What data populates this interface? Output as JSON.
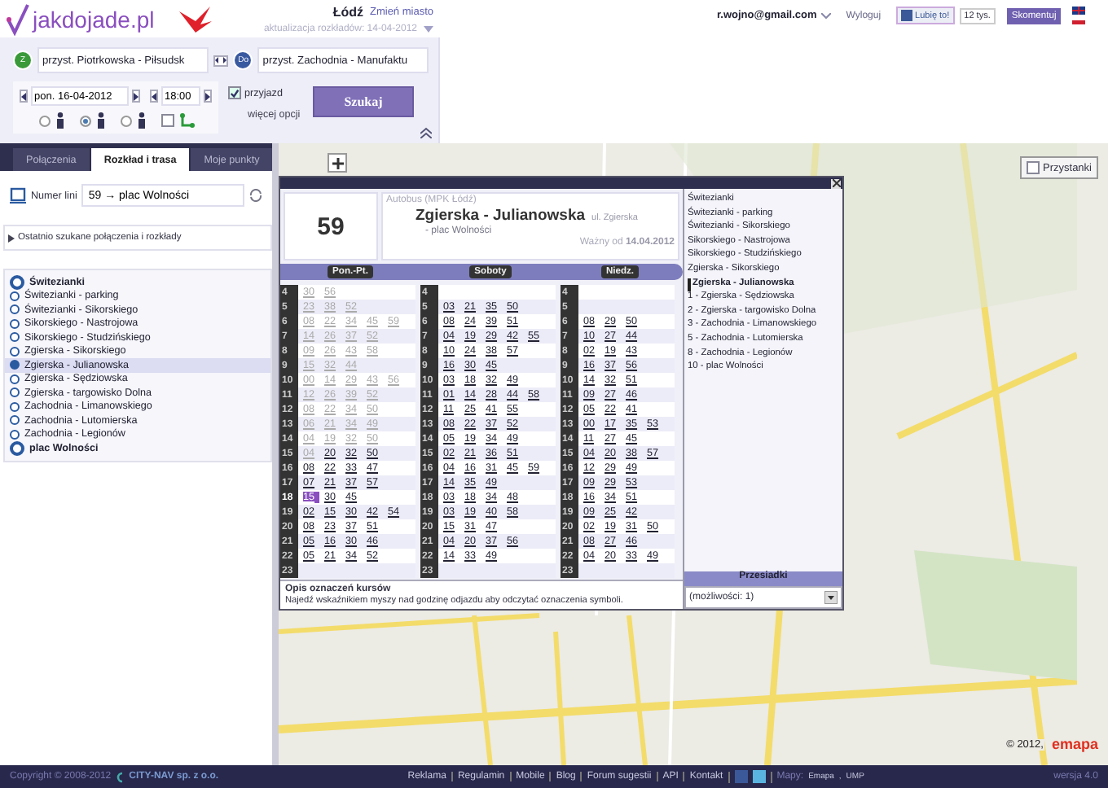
{
  "header": {
    "logo": "jakdojade.pl",
    "city": "Łódź",
    "change_city": "Zmień miasto",
    "update_note": "aktualizacja rozkładów: 14-04-2012",
    "from": {
      "badge": "Z",
      "value": "przyst. Piotrkowska - Piłsudsk"
    },
    "to": {
      "badge": "Do",
      "value": "przyst. Zachodnia - Manufaktu"
    },
    "date": "pon. 16-04-2012",
    "time": "18:00",
    "arrival": {
      "label": "przyjazd",
      "checked": true
    },
    "modes": [
      {
        "selected": false
      },
      {
        "selected": true
      },
      {
        "selected": false
      }
    ],
    "route_option": {
      "checked": false
    },
    "more_options": "więcej opcji",
    "search_button": "Szukaj"
  },
  "user_bar": {
    "email": "r.wojno@gmail.com",
    "logout": "Wyloguj",
    "like": "Lubię to!",
    "like_count": "12 tys.",
    "comment": "Skomentuj"
  },
  "sidebar": {
    "tabs": [
      {
        "label": "Połączenia",
        "selected": false
      },
      {
        "label": "Rozkład i trasa",
        "selected": true
      },
      {
        "label": "Moje punkty",
        "selected": false
      }
    ],
    "line_label": "Numer lini",
    "line_value": "59 → plac Wolności",
    "recent": "Ostatnio szukane połączenia i rozkłady",
    "stops": [
      {
        "name": "Świtezianki",
        "terminal": true,
        "selected": false
      },
      {
        "name": "Świtezianki - parking",
        "terminal": false,
        "selected": false
      },
      {
        "name": "Świtezianki - Sikorskiego",
        "terminal": false,
        "selected": false
      },
      {
        "name": "Sikorskiego - Nastrojowa",
        "terminal": false,
        "selected": false
      },
      {
        "name": "Sikorskiego - Studzińskiego",
        "terminal": false,
        "selected": false
      },
      {
        "name": "Zgierska - Sikorskiego",
        "terminal": false,
        "selected": false
      },
      {
        "name": "Zgierska - Julianowska",
        "terminal": false,
        "selected": true
      },
      {
        "name": "Zgierska - Sędziowska",
        "terminal": false,
        "selected": false
      },
      {
        "name": "Zgierska - targowisko Dolna",
        "terminal": false,
        "selected": false
      },
      {
        "name": "Zachodnia - Limanowskiego",
        "terminal": false,
        "selected": false
      },
      {
        "name": "Zachodnia - Lutomierska",
        "terminal": false,
        "selected": false
      },
      {
        "name": "Zachodnia - Legionów",
        "terminal": false,
        "selected": false
      },
      {
        "name": "plac Wolności",
        "terminal": true,
        "selected": false
      }
    ]
  },
  "map": {
    "stops_toggle": {
      "label": "Przystanki",
      "checked": false
    },
    "copyright": "© 2012,",
    "provider": "emapa"
  },
  "timetable": {
    "line": "59",
    "vehicle": "Autobus (MPK Łódź)",
    "stop": "Zgierska - Julianowska",
    "street": "ul. Zgierska",
    "direction": "- plac Wolności",
    "valid": "Ważny od **14.04.2012**",
    "columns": [
      {
        "label": "Pon.-Pt.",
        "rows": [
          {
            "hour": "4",
            "past": [
              "30",
              "56"
            ],
            "highlight": false
          },
          {
            "hour": "5",
            "past": [
              "23",
              "38",
              "52"
            ],
            "highlight": false
          },
          {
            "hour": "6",
            "past": [
              "08",
              "22",
              "34",
              "45",
              "59"
            ],
            "highlight": false
          },
          {
            "hour": "7",
            "past": [
              "14",
              "26",
              "37",
              "52"
            ],
            "highlight": false
          },
          {
            "hour": "8",
            "past": [
              "09",
              "26",
              "43",
              "58"
            ],
            "highlight": false
          },
          {
            "hour": "9",
            "past": [
              "15",
              "32",
              "44"
            ],
            "highlight": false
          },
          {
            "hour": "10",
            "past": [
              "00",
              "14",
              "29",
              "43",
              "56"
            ],
            "highlight": false
          },
          {
            "hour": "11",
            "past": [
              "12",
              "26",
              "39",
              "52"
            ],
            "highlight": false
          },
          {
            "hour": "12",
            "past": [
              "08",
              "22",
              "34",
              "50"
            ],
            "highlight": false
          },
          {
            "hour": "13",
            "past": [
              "06",
              "21",
              "34",
              "49"
            ],
            "highlight": false
          },
          {
            "hour": "14",
            "past": [
              "04",
              "19",
              "32",
              "50"
            ],
            "highlight": false
          },
          {
            "hour": "15",
            "past": [
              "04"
            ],
            "next": [
              "20",
              "32",
              "50"
            ],
            "highlight": false
          },
          {
            "hour": "16",
            "next": [
              "08",
              "22",
              "33",
              "47"
            ],
            "highlight": false
          },
          {
            "hour": "17",
            "next": [
              "07",
              "21",
              "37",
              "57"
            ],
            "highlight": false
          },
          {
            "hour": "18",
            "next": [
              "15",
              "30",
              "45"
            ],
            "highlight": true
          },
          {
            "hour": "19",
            "next": [
              "02",
              "15",
              "30",
              "42",
              "54"
            ],
            "highlight": false
          },
          {
            "hour": "20",
            "next": [
              "08",
              "23",
              "37",
              "51"
            ],
            "highlight": false
          },
          {
            "hour": "21",
            "next": [
              "05",
              "16",
              "30",
              "46"
            ],
            "highlight": false
          },
          {
            "hour": "22",
            "next": [
              "05",
              "21",
              "34",
              "52"
            ],
            "highlight": false
          },
          {
            "hour": "23",
            "highlight": false
          }
        ]
      },
      {
        "label": "Soboty",
        "rows": [
          {
            "hour": "4",
            "highlight": false
          },
          {
            "hour": "5",
            "next": [
              "03",
              "21",
              "35",
              "50"
            ],
            "highlight": false
          },
          {
            "hour": "6",
            "next": [
              "08",
              "24",
              "39",
              "51"
            ],
            "highlight": false
          },
          {
            "hour": "7",
            "next": [
              "04",
              "19",
              "29",
              "42",
              "55"
            ],
            "highlight": false
          },
          {
            "hour": "8",
            "next": [
              "10",
              "24",
              "38",
              "57"
            ],
            "highlight": false
          },
          {
            "hour": "9",
            "next": [
              "16",
              "30",
              "45"
            ],
            "highlight": false
          },
          {
            "hour": "10",
            "next": [
              "03",
              "18",
              "32",
              "49"
            ],
            "highlight": false
          },
          {
            "hour": "11",
            "next": [
              "01",
              "14",
              "28",
              "44",
              "58"
            ],
            "highlight": false
          },
          {
            "hour": "12",
            "next": [
              "11",
              "25",
              "41",
              "55"
            ],
            "highlight": false
          },
          {
            "hour": "13",
            "next": [
              "08",
              "22",
              "37",
              "52"
            ],
            "highlight": false
          },
          {
            "hour": "14",
            "next": [
              "05",
              "19",
              "34",
              "49"
            ],
            "highlight": false
          },
          {
            "hour": "15",
            "next": [
              "02",
              "21",
              "36",
              "51"
            ],
            "highlight": false
          },
          {
            "hour": "16",
            "next": [
              "04",
              "16",
              "31",
              "45",
              "59"
            ],
            "highlight": false
          },
          {
            "hour": "17",
            "next": [
              "14",
              "35",
              "49"
            ],
            "highlight": false
          },
          {
            "hour": "18",
            "next": [
              "03",
              "18",
              "34",
              "48"
            ],
            "highlight": false
          },
          {
            "hour": "19",
            "next": [
              "03",
              "19",
              "40",
              "58"
            ],
            "highlight": false
          },
          {
            "hour": "20",
            "next": [
              "15",
              "31",
              "47"
            ],
            "highlight": false
          },
          {
            "hour": "21",
            "next": [
              "04",
              "20",
              "37",
              "56"
            ],
            "highlight": false
          },
          {
            "hour": "22",
            "next": [
              "14",
              "33",
              "49"
            ],
            "highlight": false
          },
          {
            "hour": "23",
            "highlight": false
          }
        ]
      },
      {
        "label": "Niedz.",
        "rows": [
          {
            "hour": "4",
            "highlight": false
          },
          {
            "hour": "5",
            "highlight": false
          },
          {
            "hour": "6",
            "next": [
              "08",
              "29",
              "50"
            ],
            "highlight": false
          },
          {
            "hour": "7",
            "next": [
              "10",
              "27",
              "44"
            ],
            "highlight": false
          },
          {
            "hour": "8",
            "next": [
              "02",
              "19",
              "43"
            ],
            "highlight": false
          },
          {
            "hour": "9",
            "next": [
              "16",
              "37",
              "56"
            ],
            "highlight": false
          },
          {
            "hour": "10",
            "next": [
              "14",
              "32",
              "51"
            ],
            "highlight": false
          },
          {
            "hour": "11",
            "next": [
              "09",
              "27",
              "46"
            ],
            "highlight": false
          },
          {
            "hour": "12",
            "next": [
              "05",
              "22",
              "41"
            ],
            "highlight": false
          },
          {
            "hour": "13",
            "next": [
              "00",
              "17",
              "35",
              "53"
            ],
            "highlight": false
          },
          {
            "hour": "14",
            "next": [
              "11",
              "27",
              "45"
            ],
            "highlight": false
          },
          {
            "hour": "15",
            "next": [
              "04",
              "20",
              "38",
              "57"
            ],
            "highlight": false
          },
          {
            "hour": "16",
            "next": [
              "12",
              "29",
              "49"
            ],
            "highlight": false
          },
          {
            "hour": "17",
            "next": [
              "09",
              "29",
              "53"
            ],
            "highlight": false
          },
          {
            "hour": "18",
            "next": [
              "16",
              "34",
              "51"
            ],
            "highlight": false
          },
          {
            "hour": "19",
            "next": [
              "09",
              "25",
              "42"
            ],
            "highlight": false
          },
          {
            "hour": "20",
            "next": [
              "02",
              "19",
              "31",
              "50"
            ],
            "highlight": false
          },
          {
            "hour": "21",
            "next": [
              "08",
              "27",
              "46"
            ],
            "highlight": false
          },
          {
            "hour": "22",
            "next": [
              "04",
              "20",
              "33",
              "49"
            ],
            "highlight": false
          },
          {
            "hour": "23",
            "highlight": false
          }
        ]
      }
    ],
    "legend_title": "Opis oznaczeń kursów",
    "legend_text": "Najedź wskaźnikiem myszy nad godzinę odjazdu aby odczytać oznaczenia symboli.",
    "stops": [
      {
        "name": "Świtezianki",
        "current": false
      },
      {
        "name": "Świtezianki - parking",
        "current": false
      },
      {
        "name": "Świtezianki - Sikorskiego",
        "current": false
      },
      {
        "name": "Sikorskiego - Nastrojowa",
        "current": false
      },
      {
        "name": "Sikorskiego - Studzińskiego",
        "current": false
      },
      {
        "name": "Zgierska - Sikorskiego",
        "current": false
      },
      {
        "name": "Zgierska - Julianowska",
        "current": true
      },
      {
        "name": "1 - Zgierska - Sędziowska",
        "current": false
      },
      {
        "name": "2 - Zgierska - targowisko Dolna",
        "current": false
      },
      {
        "name": "3 - Zachodnia - Limanowskiego",
        "current": false
      },
      {
        "name": "5 - Zachodnia - Lutomierska",
        "current": false
      },
      {
        "name": "8 - Zachodnia - Legionów",
        "current": false
      },
      {
        "name": "10 - plac Wolności",
        "current": false
      }
    ],
    "transfers_label": "Przesiadki",
    "transfers_value": "(możliwości: 1)"
  },
  "footer": {
    "copyright": "Copyright © 2008-2012",
    "company": "CITY-NAV sp. z o.o.",
    "links": [
      "Reklama",
      "Regulamin",
      "Mobile",
      "Blog",
      "Forum sugestii",
      "API",
      "Kontakt"
    ],
    "maps_label": "Mapy:",
    "map_sources": [
      "Emapa",
      "UMP"
    ],
    "source_separator": ",",
    "version": "wersja 4.0"
  }
}
